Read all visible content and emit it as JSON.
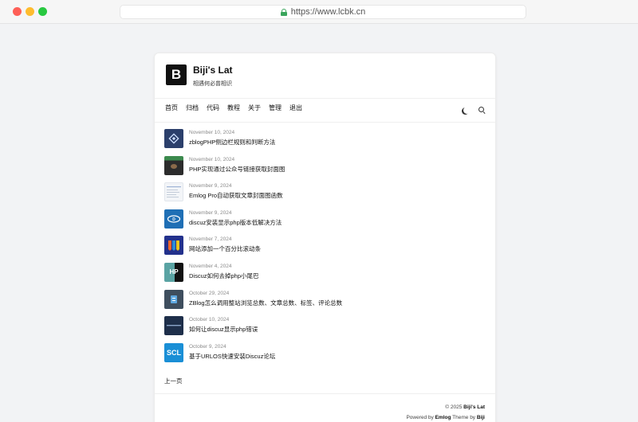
{
  "browser": {
    "url": "https://www.lcbk.cn"
  },
  "site": {
    "logo_letter": "B",
    "title": "Biji's Lat",
    "subtitle": "相遇何必曾相识"
  },
  "nav": [
    "首页",
    "归档",
    "代码",
    "教程",
    "关于",
    "管理",
    "退出"
  ],
  "icons": {
    "theme_toggle": "moon-icon",
    "search": "search-icon"
  },
  "posts": [
    {
      "date": "November 10, 2024",
      "title": "zblogPHP侧边栏规则和判断方法"
    },
    {
      "date": "November 10, 2024",
      "title": "PHP实现通过公众号链接获取封面图"
    },
    {
      "date": "November 9, 2024",
      "title": "Emlog Pro自动获取文章封面图函数"
    },
    {
      "date": "November 9, 2024",
      "title": "discuz安装显示php版本低解决方法"
    },
    {
      "date": "November 7, 2024",
      "title": "网站添加一个百分比滚动条"
    },
    {
      "date": "November 4, 2024",
      "title": "Discuz如何去掉php小尾巴"
    },
    {
      "date": "October 29, 2024",
      "title": "ZBlog怎么调用整站浏览总数、文章总数、标签、评论总数"
    },
    {
      "date": "October 10, 2024",
      "title": "如何让discuz显示php错误"
    },
    {
      "date": "October 9, 2024",
      "title": "基于URLOS快速安装Discuz论坛"
    }
  ],
  "thumb_labels": [
    "",
    "",
    "",
    "",
    "",
    "HP",
    "",
    "",
    "SCL"
  ],
  "pager": {
    "prev": "上一页"
  },
  "footer": {
    "copyright_prefix": "© 2025",
    "site_name": "Biji's Lat",
    "powered_prefix": "Powered by",
    "cms": "Emlog",
    "theme_word": "Theme by",
    "author": "Biji"
  }
}
